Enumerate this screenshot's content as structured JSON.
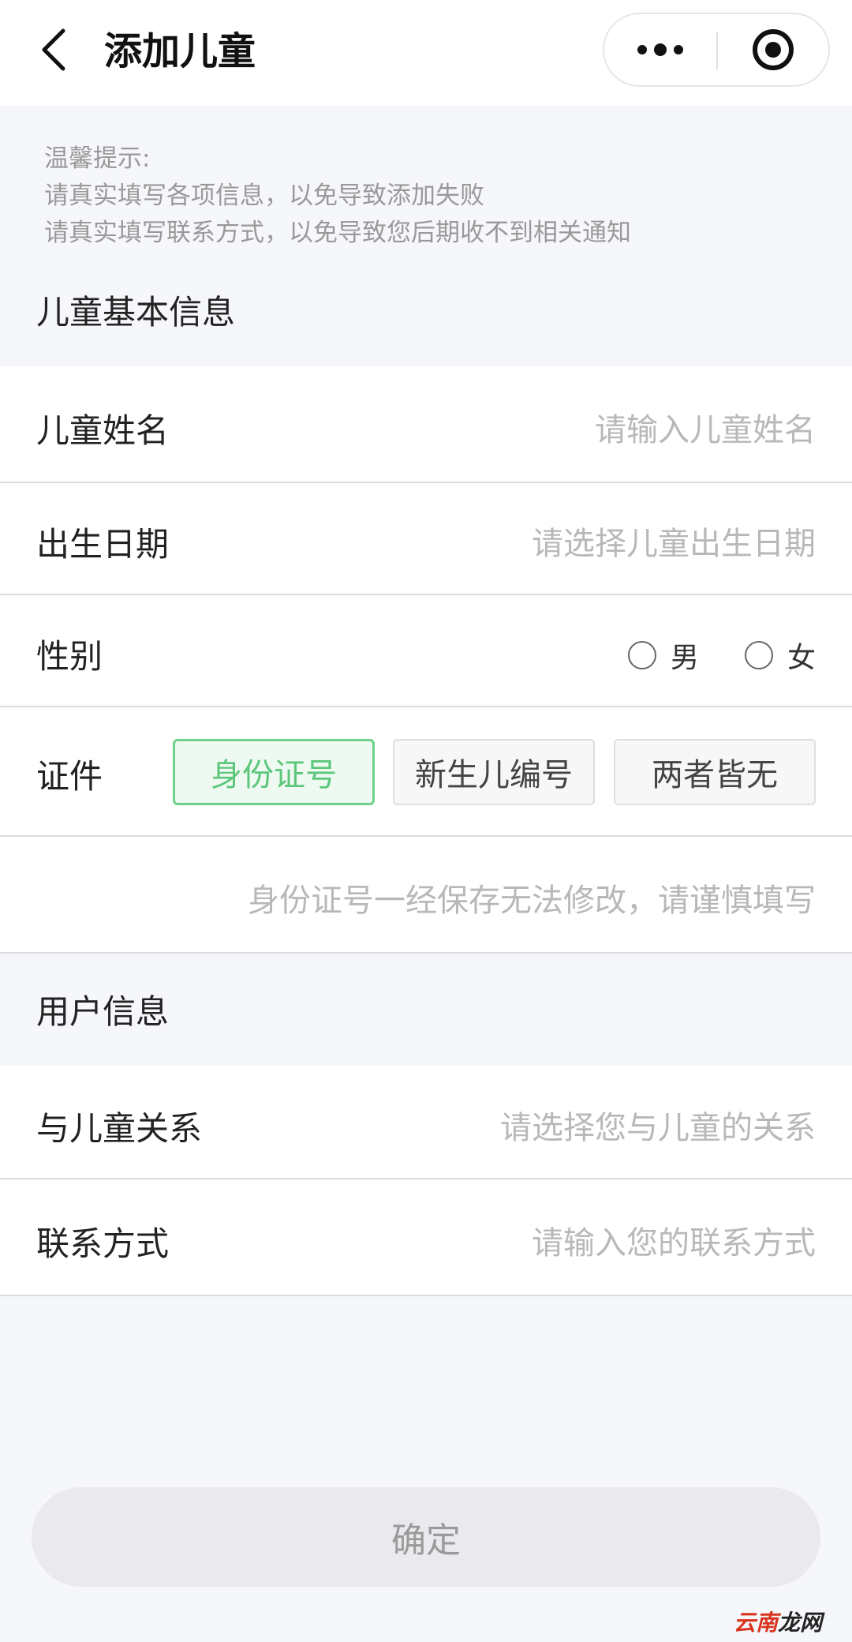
{
  "nav": {
    "title": "添加儿童",
    "back_icon": "chevron-left-icon",
    "more_icon": "more-dots-icon",
    "target_icon": "target-icon"
  },
  "tips": {
    "line1": "温馨提示:",
    "line2": "请真实填写各项信息，以免导致添加失败",
    "line3": "请真实填写联系方式，以免导致您后期收不到相关通知"
  },
  "child_section": {
    "title": "儿童基本信息",
    "name": {
      "label": "儿童姓名",
      "placeholder": "请输入儿童姓名"
    },
    "birthday": {
      "label": "出生日期",
      "placeholder": "请选择儿童出生日期"
    },
    "gender": {
      "label": "性别",
      "male": "男",
      "female": "女"
    },
    "id_type": {
      "label": "证件",
      "options": [
        "身份证号",
        "新生儿编号",
        "两者皆无"
      ],
      "selected": "身份证号"
    },
    "id_number": {
      "placeholder": "身份证号一经保存无法修改，请谨慎填写"
    }
  },
  "user_section": {
    "title": "用户信息",
    "relation": {
      "label": "与儿童关系",
      "placeholder": "请选择您与儿童的关系"
    },
    "contact": {
      "label": "联系方式",
      "placeholder": "请输入您的联系方式"
    }
  },
  "confirm_label": "确定",
  "watermark": {
    "part1": "云南",
    "part2": "龙网"
  },
  "colors": {
    "accent_green": "#5cc77b",
    "background": "#f6f7fb",
    "placeholder": "#b8b8b8"
  }
}
